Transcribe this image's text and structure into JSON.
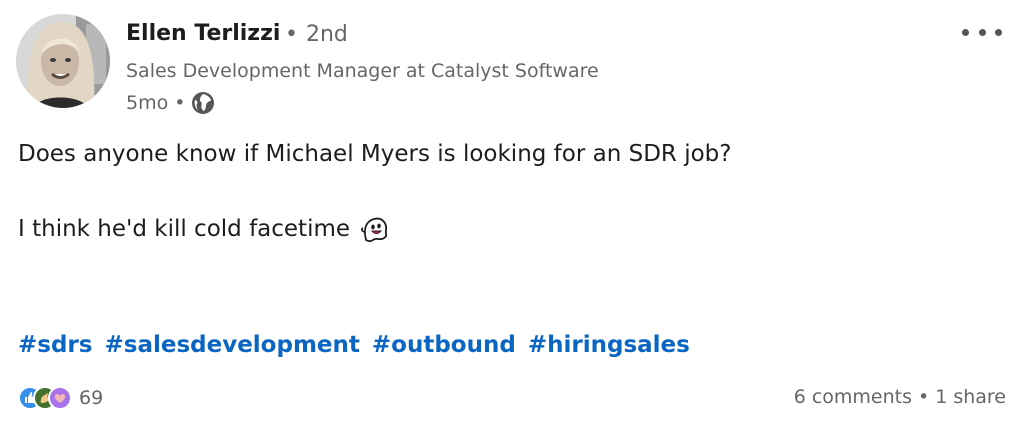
{
  "author": {
    "name": "Ellen Terlizzi",
    "degree": "2nd",
    "headline": "Sales Development Manager at Catalyst Software",
    "time": "5mo",
    "visibility_icon": "globe-icon"
  },
  "post": {
    "line1": "Does anyone know if Michael Myers is looking for an SDR job?",
    "line2": "I think he'd kill cold facetime",
    "emoji": "ghost-emoji",
    "hashtags": [
      "#sdrs",
      "#salesdevelopment",
      "#outbound",
      "#hiringsales"
    ]
  },
  "social": {
    "reaction_icons": [
      "like-icon",
      "celebrate-icon",
      "love-icon"
    ],
    "reaction_count": "69",
    "comments": "6 comments",
    "shares": "1 share"
  },
  "colors": {
    "link": "#0a66c2",
    "secondary_text": "#666666",
    "primary_text": "#1d1d1d"
  }
}
